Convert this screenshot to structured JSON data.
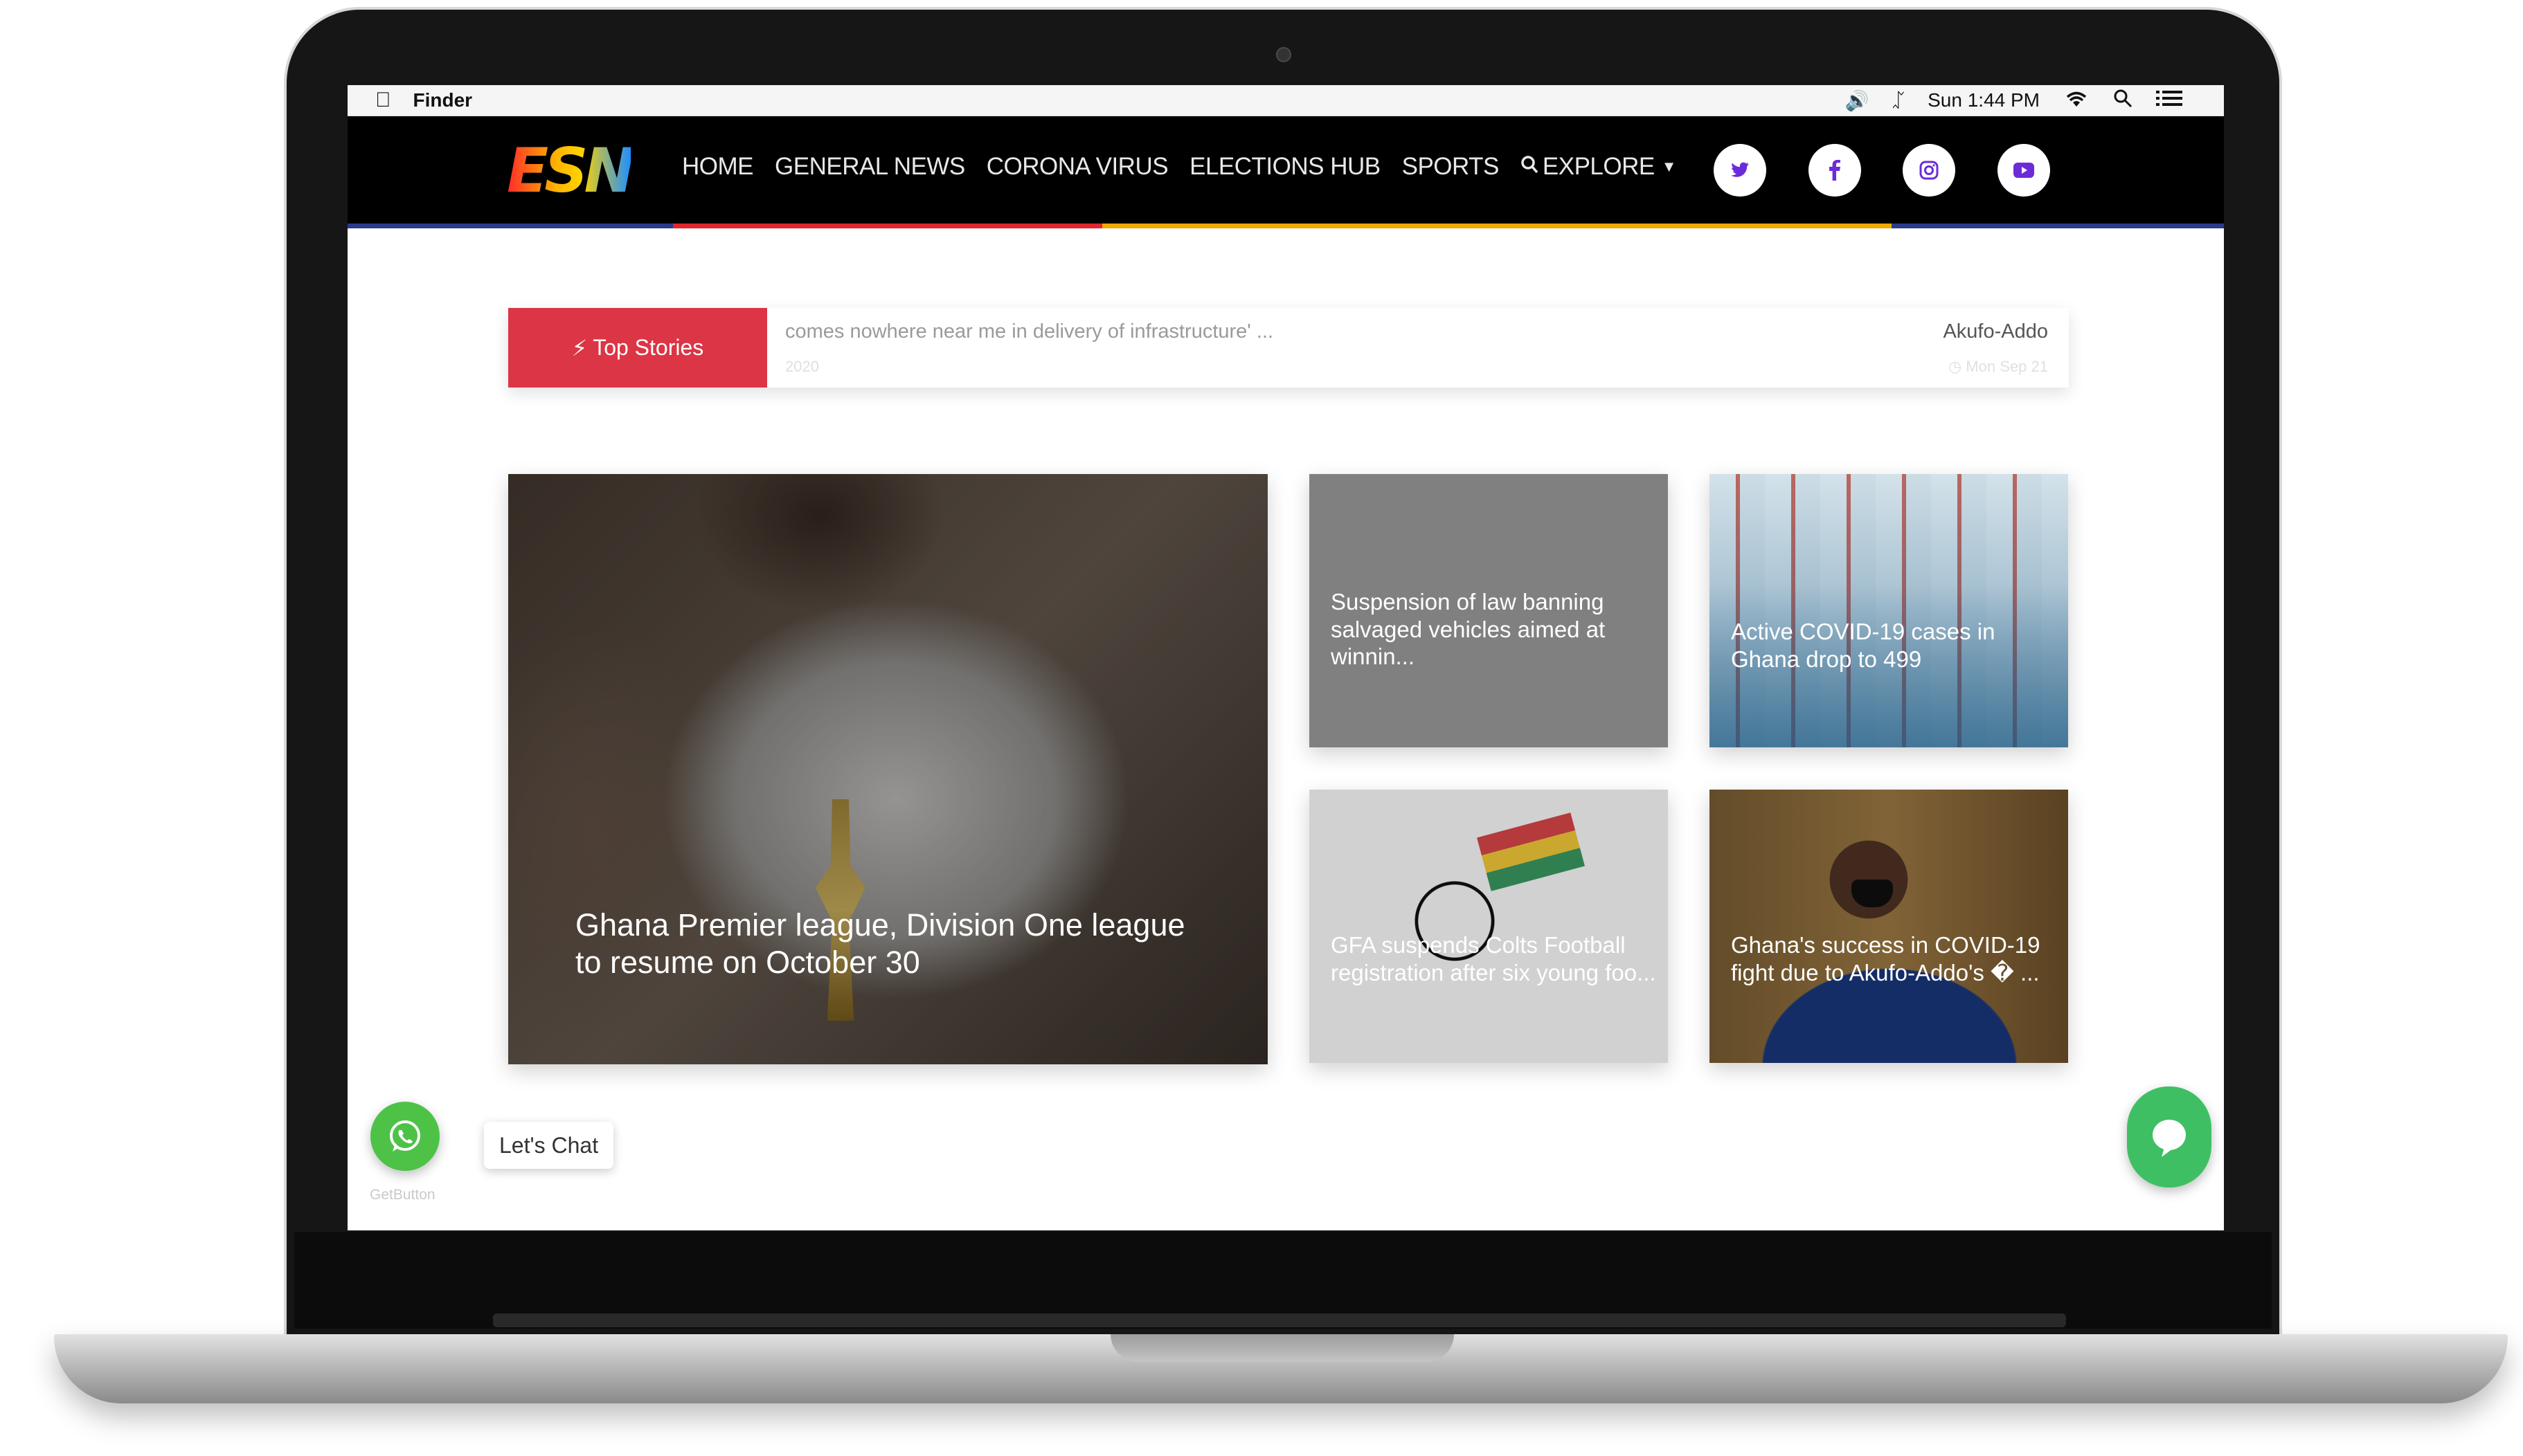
{
  "menubar": {
    "app_name": "Finder",
    "clock": "Sun 1:44 PM",
    "icons": [
      "apple-icon",
      "volume-icon",
      "bluetooth-icon",
      "wifi-icon",
      "search-icon",
      "list-icon"
    ]
  },
  "site": {
    "logo_text": "ESN",
    "nav": [
      "HOME",
      "GENERAL NEWS",
      "CORONA VIRUS",
      "ELECTIONS HUB",
      "SPORTS",
      "EXPLORE"
    ],
    "social": [
      "twitter-icon",
      "facebook-icon",
      "instagram-icon",
      "youtube-icon"
    ],
    "stripe_colors": [
      "#2a3a8c",
      "#e1262c",
      "#f2a900",
      "#2a3a8c"
    ]
  },
  "ticker": {
    "label": "Top Stories",
    "headline": "comes nowhere near me in delivery of infrastructure' ...",
    "headline_sub": "2020",
    "source": "Akufo-Addo",
    "date": "Mon Sep 21"
  },
  "cards": [
    {
      "title": "Ghana Premier league, Division One league to resume on October 30"
    },
    {
      "title": "Suspension of law banning salvaged vehicles aimed at winnin..."
    },
    {
      "title": "Active COVID-19 cases in Ghana drop to 499"
    },
    {
      "title": "GFA suspends Colts Football registration after six young foo..."
    },
    {
      "title": "Ghana's success in COVID-19 fight due to Akufo-Addo's � ..."
    }
  ],
  "chat": {
    "tooltip": "Let's Chat",
    "brand": "GetButton"
  }
}
